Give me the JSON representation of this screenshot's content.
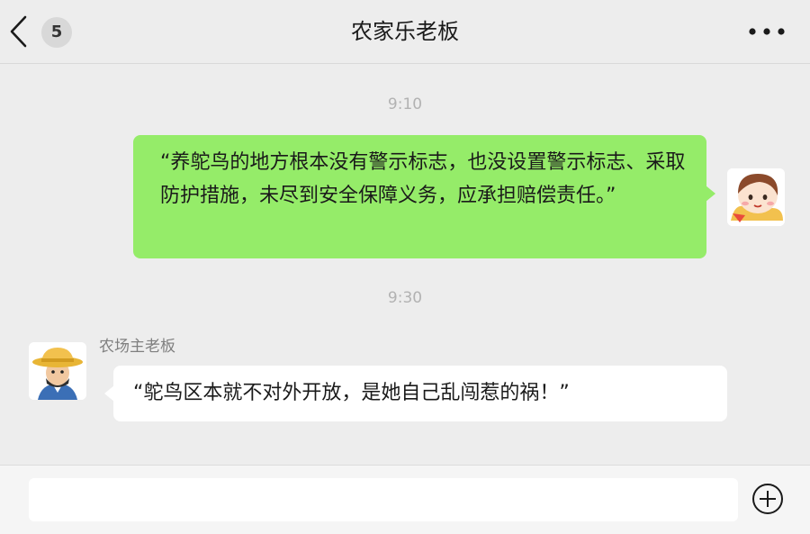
{
  "header": {
    "title": "农家乐老板",
    "unread_count": "5"
  },
  "messages": [
    {
      "time": "9:10",
      "direction": "sent",
      "text": "“养鸵鸟的地方根本没有警示标志，也没设置警示标志、采取防护措施，未尽到安全保障义务，应承担赔偿责任。”"
    },
    {
      "time": "9:30",
      "direction": "received",
      "sender": "农场主老板",
      "text": "“鸵鸟区本就不对外开放，是她自己乱闯惹的祸！”"
    }
  ],
  "input_bar": {
    "placeholder": ""
  },
  "colors": {
    "background": "#EDEDED",
    "sent_bubble": "#95EC69",
    "received_bubble": "#FFFFFF",
    "timestamp": "#B2B2B2"
  },
  "icons": {
    "back": "back-arrow-icon",
    "more": "more-dots-icon",
    "add": "plus-circle-icon"
  }
}
